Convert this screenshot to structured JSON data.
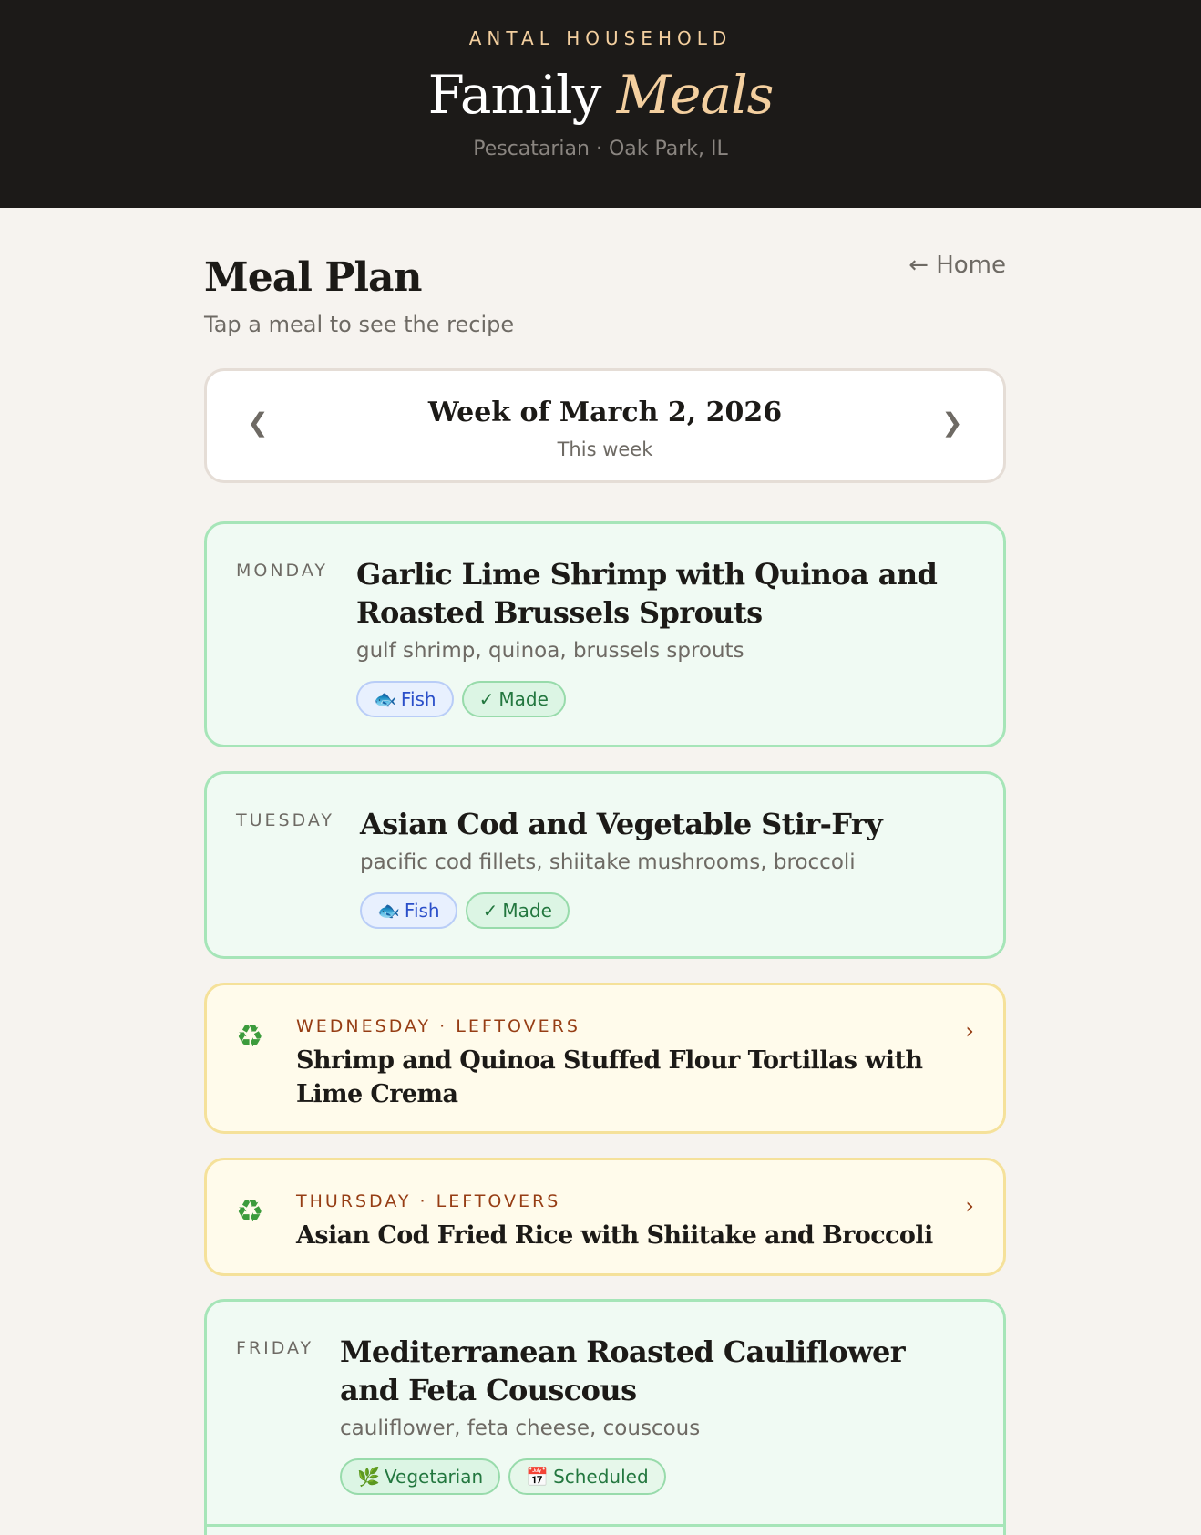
{
  "header": {
    "household": "ANTAL HOUSEHOLD",
    "brand_main": "Family",
    "brand_accent": "Meals",
    "tagline": "Pescatarian · Oak Park, IL"
  },
  "page": {
    "title": "Meal Plan",
    "subtitle": "Tap a meal to see the recipe",
    "home_link": "← Home"
  },
  "week": {
    "prev": "❮",
    "next": "❯",
    "title": "Week of March 2, 2026",
    "subtitle": "This week"
  },
  "meals": [
    {
      "day": "MONDAY",
      "title": "Garlic Lime Shrimp with Quinoa and Roasted Brussels Sprouts",
      "ingredients": "gulf shrimp, quinoa, brussels sprouts",
      "tags": [
        {
          "icon": "🐟",
          "label": "Fish"
        },
        {
          "icon": "✓",
          "label": "Made"
        }
      ]
    },
    {
      "day": "TUESDAY",
      "title": "Asian Cod and Vegetable Stir-Fry",
      "ingredients": "pacific cod fillets, shiitake mushrooms, broccoli",
      "tags": [
        {
          "icon": "🐟",
          "label": "Fish"
        },
        {
          "icon": "✓",
          "label": "Made"
        }
      ]
    },
    {
      "day": "FRIDAY",
      "title": "Mediterranean Roasted Cauliflower and Feta Couscous",
      "ingredients": "cauliflower, feta cheese, couscous",
      "tags": [
        {
          "icon": "🌿",
          "label": "Vegetarian"
        },
        {
          "icon": "📅",
          "label": "Scheduled"
        }
      ]
    }
  ],
  "leftovers": [
    {
      "icon": "♻",
      "day": "WEDNESDAY · LEFTOVERS",
      "title": "Shrimp and Quinoa Stuffed Flour Tortillas with Lime Crema",
      "chevron": "›"
    },
    {
      "icon": "♻",
      "day": "THURSDAY · LEFTOVERS",
      "title": "Asian Cod Fried Rice with Shiitake and Broccoli",
      "chevron": "›"
    }
  ]
}
